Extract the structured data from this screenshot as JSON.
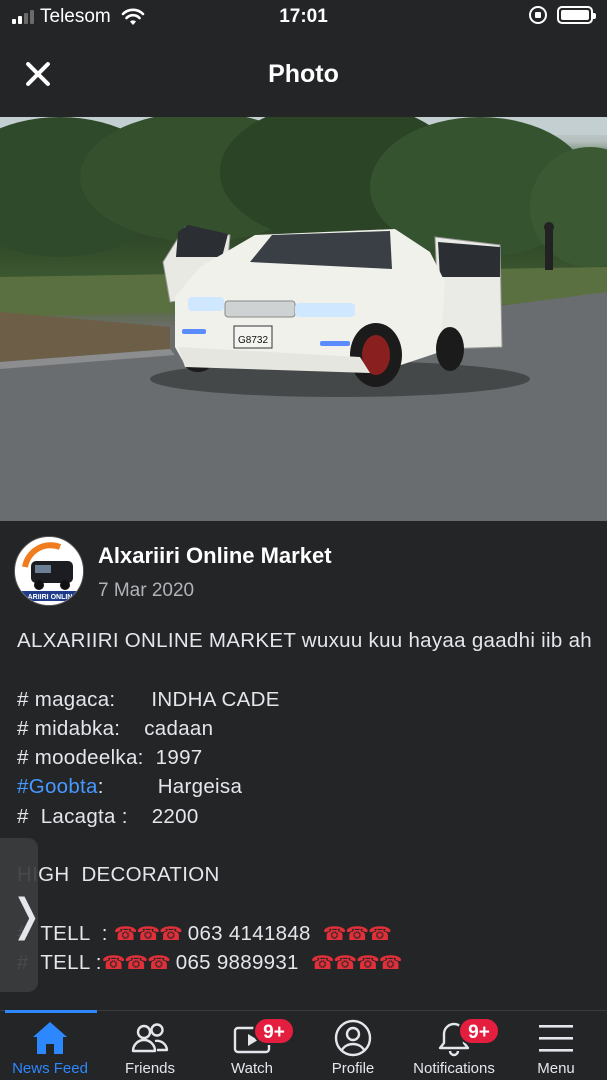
{
  "status_bar": {
    "carrier": "Telesom",
    "time": "17:01"
  },
  "header": {
    "title": "Photo"
  },
  "post": {
    "page_name": "Alxariiri Online Market",
    "date": "7 Mar 2020",
    "avatar_text": "ARIIRI ONLIN",
    "intro": "ALXARIIRI ONLINE MARKET wuxuu  kuu hayaa gaadhi iib ah",
    "lines": {
      "magaca": "# magaca:      INDHA CADE",
      "midabka": "# midabka:    cadaan",
      "moodeelka": "# moodeelka:  1997",
      "goobta_tag": "#Goobta",
      "goobta_rest": ":         Hargeisa",
      "lacagta": "#  Lacagta :    2200",
      "decoration": "HIGH  DECORATION",
      "tell1_label": "#  TELL  :",
      "tell1_number": "063 4141848",
      "tell2_label": "#  TELL :",
      "tell2_number": "065 9889931",
      "phones_3": "☎☎☎",
      "phones_4": "☎☎☎☎"
    }
  },
  "photo": {
    "plate": "G8732"
  },
  "side_handle": {
    "glyph": "❭"
  },
  "tabbar": {
    "tabs": [
      {
        "label": "News Feed",
        "icon": "home-icon",
        "active": true
      },
      {
        "label": "Friends",
        "icon": "friends-icon"
      },
      {
        "label": "Watch",
        "icon": "watch-icon",
        "badge": "9+"
      },
      {
        "label": "Profile",
        "icon": "profile-icon"
      },
      {
        "label": "Notifications",
        "icon": "bell-icon",
        "badge": "9+"
      },
      {
        "label": "Menu",
        "icon": "menu-icon"
      }
    ]
  },
  "colors": {
    "background": "#242527",
    "accent": "#2d88ff",
    "badge": "#e41e3f",
    "hashtag": "#4599ff"
  }
}
